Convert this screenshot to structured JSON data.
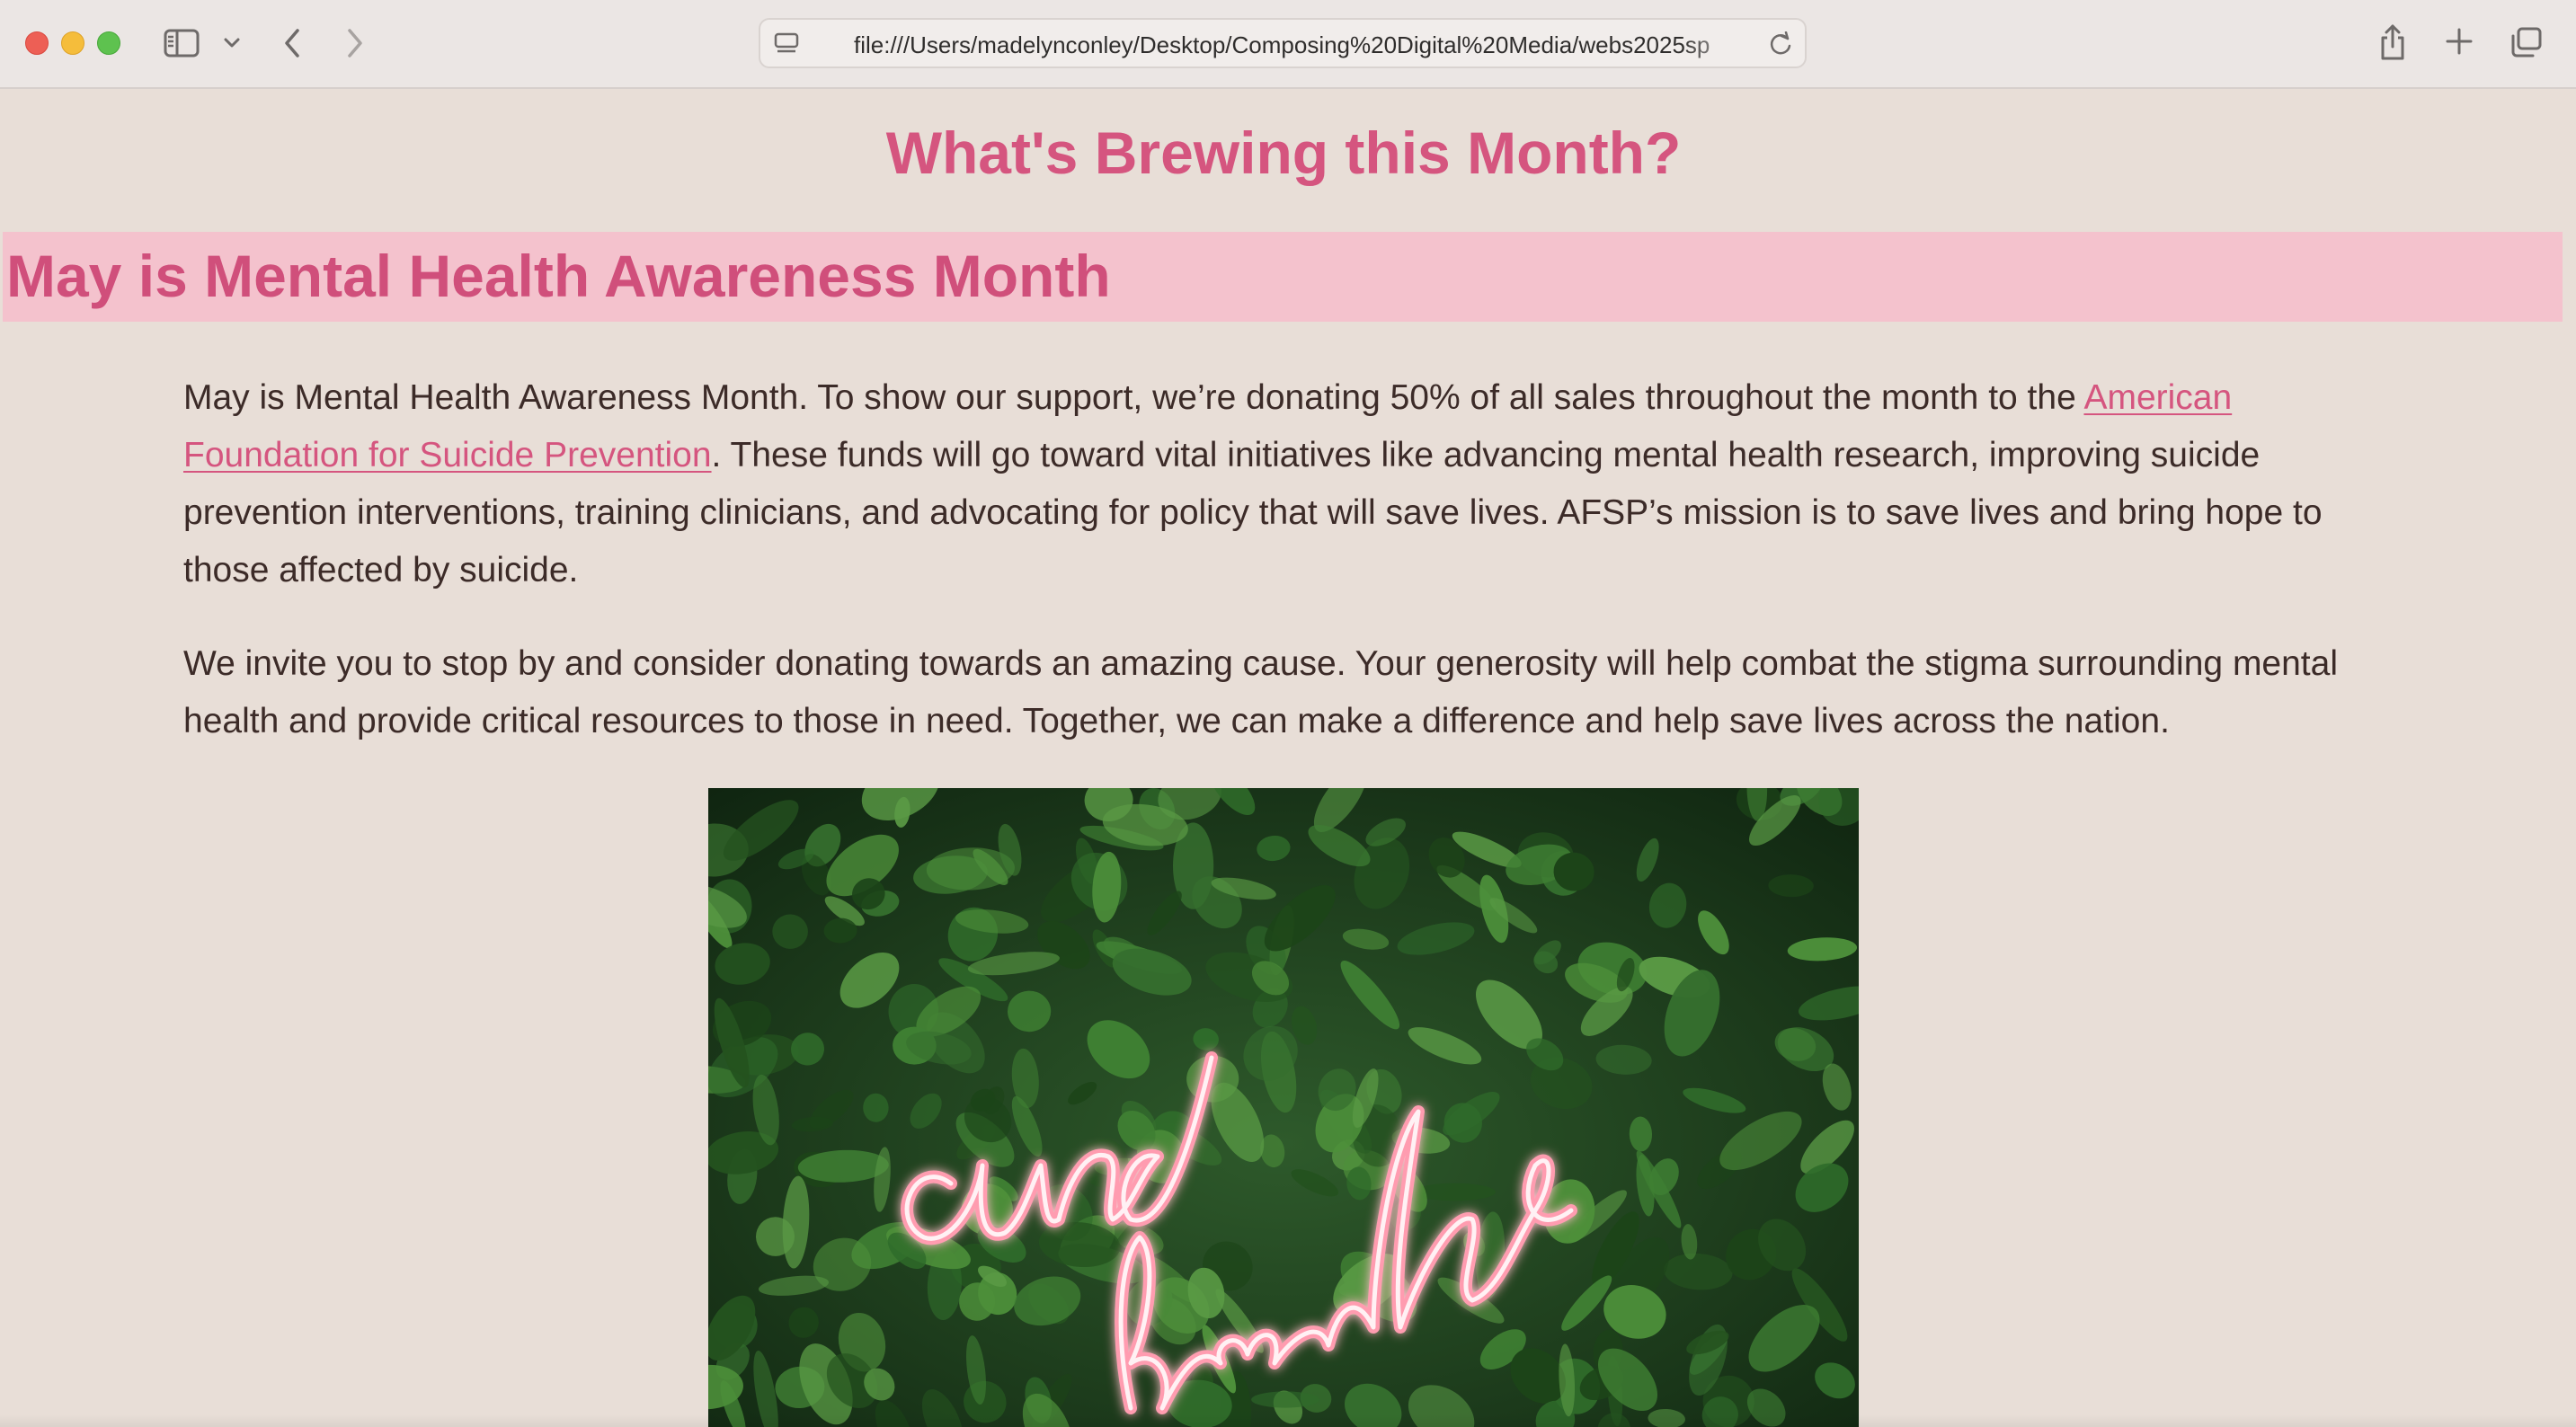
{
  "browser": {
    "url": "file:///Users/madelynconley/Desktop/Composing%20Digital%20Media/webs2025sp"
  },
  "page": {
    "title": "What's Brewing this Month?",
    "section_heading": "May is Mental Health Awareness Month",
    "paragraph1": {
      "before_link": "May is Mental Health Awareness Month. To show our support, we’re donating 50% of all sales throughout the month to the ",
      "link_text": "American Foundation for Suicide Prevention",
      "after_link": ". These funds will go toward vital initiatives like advancing mental health research, improving suicide prevention interventions, training clinicians, and advocating for policy that will save lives. AFSP’s mission is to save lives and bring hope to those affected by suicide."
    },
    "paragraph2": "We invite you to stop by and consider donating towards an amazing cause. Your generosity will help combat the stigma surrounding mental health and provide critical resources to those in need. Together, we can make a difference and help save lives across the nation.",
    "photo": {
      "neon_text": "and breathe"
    }
  },
  "colors": {
    "page_background": "#e8ded7",
    "accent_pink": "#d5557f",
    "heading_band": "#f4c2cd",
    "body_text": "#3c2b28"
  },
  "icons": {
    "close": "close-button-icon",
    "minimize": "minimize-button-icon",
    "zoom": "zoom-button-icon",
    "sidebar": "sidebar-icon",
    "sidebar_menu": "chevron-down-icon",
    "back": "chevron-left-icon",
    "forward": "chevron-right-icon",
    "page_menu": "page-settings-icon",
    "reload": "reload-icon",
    "share": "share-icon",
    "new_tab": "plus-icon",
    "tab_overview": "tab-overview-icon"
  }
}
